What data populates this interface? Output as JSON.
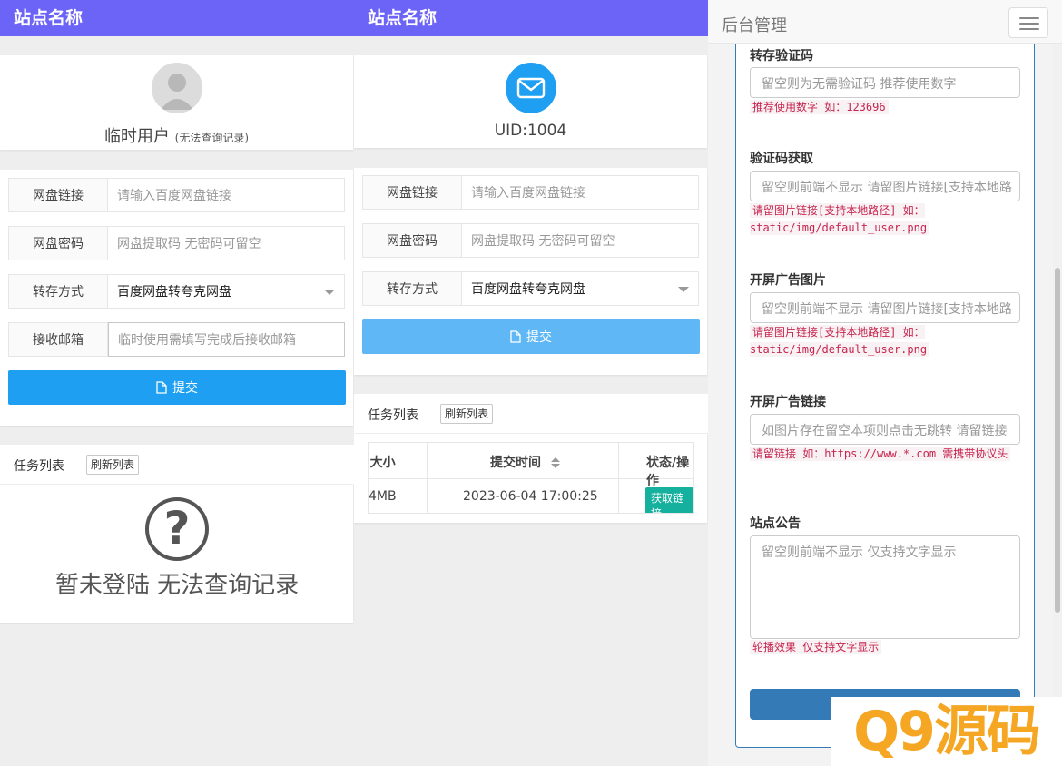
{
  "col1": {
    "site_name": "站点名称",
    "user_name": "临时用户",
    "user_note": "(无法查询记录)",
    "form": {
      "link_label": "网盘链接",
      "link_placeholder": "请输入百度网盘链接",
      "pwd_label": "网盘密码",
      "pwd_placeholder": "网盘提取码 无密码可留空",
      "mode_label": "转存方式",
      "mode_value": "百度网盘转夸克网盘",
      "email_label": "接收邮箱",
      "email_placeholder": "临时使用需填写完成后接收邮箱",
      "submit_label": "提交"
    },
    "tasks": {
      "title": "任务列表",
      "refresh_label": "刷新列表",
      "empty_message": "暂未登陆 无法查询记录"
    }
  },
  "col2": {
    "site_name": "站点名称",
    "uid": "UID:1004",
    "form": {
      "link_label": "网盘链接",
      "link_placeholder": "请输入百度网盘链接",
      "pwd_label": "网盘密码",
      "pwd_placeholder": "网盘提取码 无密码可留空",
      "mode_label": "转存方式",
      "mode_value": "百度网盘转夸克网盘",
      "submit_label": "提交"
    },
    "tasks": {
      "title": "任务列表",
      "refresh_label": "刷新列表",
      "columns": [
        ":大小",
        "提交时间",
        "状态/操作"
      ],
      "rows": [
        {
          "size": "4MB",
          "time": "2023-06-04 17:00:25",
          "action": "获取链接"
        }
      ]
    }
  },
  "admin": {
    "title": "后台管理",
    "fields": [
      {
        "label": "转存验证码",
        "placeholder": "留空则为无需验证码 推荐使用数字",
        "help": "推荐使用数字 如：123696"
      },
      {
        "label": "验证码获取",
        "placeholder": "留空则前端不显示 请留图片链接[支持本地路",
        "help": "请留图片链接[支持本地路径] 如：static/img/default_user.png"
      },
      {
        "label": "开屏广告图片",
        "placeholder": "留空则前端不显示 请留图片链接[支持本地路",
        "help": "请留图片链接[支持本地路径] 如：static/img/default_user.png"
      },
      {
        "label": "开屏广告链接",
        "placeholder": "如图片存在留空本项则点击无跳转 请留链接",
        "help": "请留链接 如：https://www.*.com 需携带协议头"
      },
      {
        "label": "站点公告",
        "placeholder": "留空则前端不显示 仅支持文字显示",
        "help": "轮播效果 仅支持文字显示"
      }
    ]
  },
  "watermark": "Q9源码",
  "colors": {
    "topbar": "#6c63f7",
    "primary": "#1e9ff2",
    "primary_light": "#5fb8f5",
    "admin_blue": "#337ab7",
    "teal": "#16b09e",
    "code_red": "#c7254e"
  }
}
